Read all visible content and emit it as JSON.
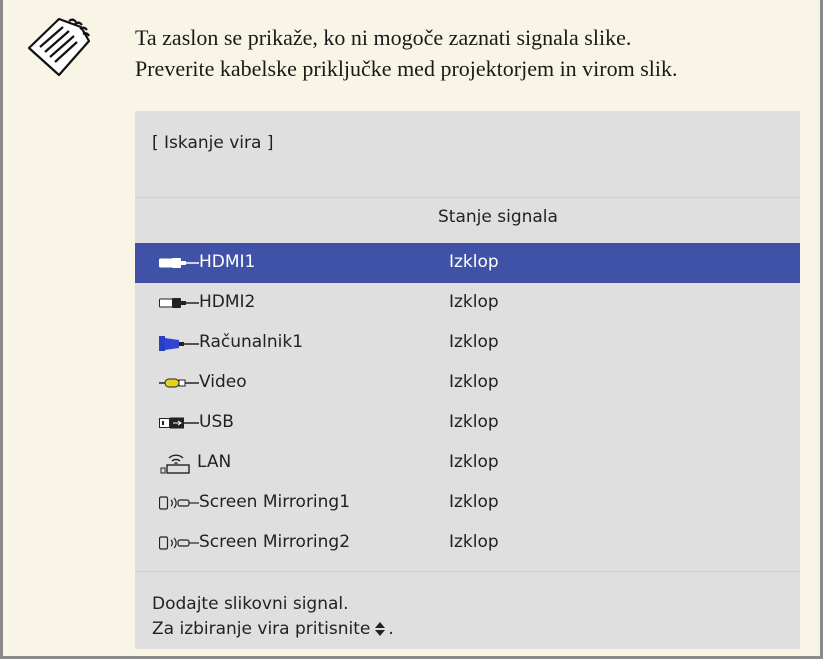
{
  "note": {
    "icon": "note-icon",
    "lines": [
      "Ta zaslon se prikaže, ko ni mogoče zaznati signala slike.",
      "Preverite kabelske priključke med projektorjem in virom slik."
    ]
  },
  "screen": {
    "title": "[ Iskanje vira ]",
    "column_header": "Stanje signala",
    "sources": [
      {
        "name": "HDMI1",
        "status": "Izklop",
        "icon": "hdmi-icon",
        "selected": true
      },
      {
        "name": "HDMI2",
        "status": "Izklop",
        "icon": "hdmi-icon",
        "selected": false
      },
      {
        "name": "Računalnik1",
        "status": "Izklop",
        "icon": "vga-icon",
        "selected": false
      },
      {
        "name": "Video",
        "status": "Izklop",
        "icon": "video-rca-icon",
        "selected": false
      },
      {
        "name": "USB",
        "status": "Izklop",
        "icon": "usb-icon",
        "selected": false
      },
      {
        "name": "LAN",
        "status": "Izklop",
        "icon": "lan-icon",
        "selected": false
      },
      {
        "name": "Screen Mirroring1",
        "status": "Izklop",
        "icon": "screen-mirroring-icon",
        "selected": false
      },
      {
        "name": "Screen Mirroring2",
        "status": "Izklop",
        "icon": "screen-mirroring-icon",
        "selected": false
      }
    ],
    "footer": {
      "line1": "Dodajte slikovni signal.",
      "line2_prefix": "Za izbiranje vira pritisnite",
      "line2_suffix": ".",
      "arrows_icon": "up-down-arrows-icon"
    },
    "colors": {
      "selected_row": "#3f52a8",
      "panel": "#dfdfdf",
      "note_background": "#f8f5e6"
    }
  }
}
